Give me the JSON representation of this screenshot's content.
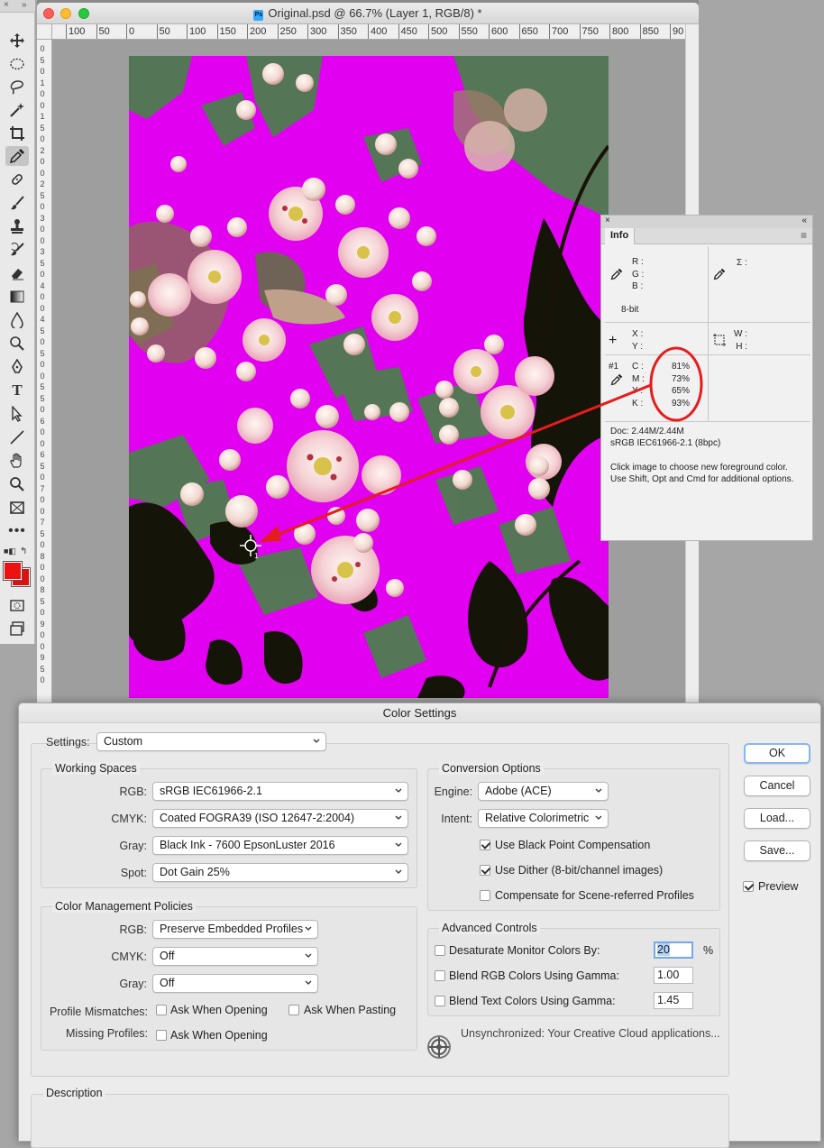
{
  "document": {
    "title": "Original.psd @ 66.7% (Layer 1, RGB/8) *",
    "ruler_h_ticks": [
      "100",
      "50",
      "0",
      "50",
      "100",
      "150",
      "200",
      "250",
      "300",
      "350",
      "400",
      "450",
      "500",
      "550",
      "600",
      "650",
      "700",
      "750",
      "800",
      "850",
      "90"
    ],
    "ruler_v_ticks": [
      "0",
      "5",
      "0",
      "1",
      "0",
      "0",
      "1",
      "5",
      "0",
      "2",
      "0",
      "0",
      "2",
      "5",
      "0",
      "3",
      "0",
      "0",
      "3",
      "5",
      "0",
      "4",
      "0",
      "0",
      "4",
      "5",
      "0",
      "5",
      "0",
      "0",
      "5",
      "5",
      "0",
      "6",
      "0",
      "0",
      "6",
      "5",
      "0",
      "7",
      "0",
      "0",
      "7",
      "5",
      "0",
      "8",
      "0",
      "0",
      "8",
      "5",
      "0",
      "9",
      "0",
      "0",
      "9",
      "5",
      "0"
    ]
  },
  "tools": [
    "move",
    "marquee",
    "lasso",
    "quick-select",
    "crop",
    "eyedropper",
    "healing",
    "brush",
    "stamp",
    "history-brush",
    "eraser",
    "gradient",
    "blur",
    "dodge",
    "pen",
    "type",
    "path-select",
    "line",
    "hand",
    "zoom",
    "frame",
    "more",
    "swap",
    "colors",
    "quickmask",
    "screen-mode"
  ],
  "colors": {
    "foreground": "#ee1111",
    "background": "#dd1111",
    "canvas": "#e100f0",
    "annotation": "#e51c1c"
  },
  "info_panel": {
    "tab": "Info",
    "rgb_labels": [
      "R :",
      "G :",
      "B :"
    ],
    "bit_depth": "8-bit",
    "sigma_label": "Σ :",
    "xy_labels": [
      "X :",
      "Y :"
    ],
    "wh_labels": [
      "W :",
      "H :"
    ],
    "sampler_id": "#1",
    "cmyk": [
      {
        "label": "C :",
        "value": "81%"
      },
      {
        "label": "M :",
        "value": "73%"
      },
      {
        "label": "Y :",
        "value": "65%"
      },
      {
        "label": "K :",
        "value": "93%"
      }
    ],
    "doc_size": "Doc: 2.44M/2.44M",
    "profile": "sRGB IEC61966-2.1 (8bpc)",
    "hint": "Click image to choose new foreground color.  Use Shift, Opt and Cmd for additional options."
  },
  "dialog": {
    "title": "Color Settings",
    "settings_label": "Settings:",
    "settings_value": "Custom",
    "working_spaces": {
      "title": "Working Spaces",
      "rows": [
        {
          "label": "RGB:",
          "value": "sRGB IEC61966-2.1"
        },
        {
          "label": "CMYK:",
          "value": "Coated FOGRA39 (ISO 12647-2:2004)"
        },
        {
          "label": "Gray:",
          "value": "Black Ink - 7600 EpsonLuster 2016"
        },
        {
          "label": "Spot:",
          "value": "Dot Gain 25%"
        }
      ]
    },
    "policies": {
      "title": "Color Management Policies",
      "rows": [
        {
          "label": "RGB:",
          "value": "Preserve Embedded Profiles"
        },
        {
          "label": "CMYK:",
          "value": "Off"
        },
        {
          "label": "Gray:",
          "value": "Off"
        }
      ],
      "mismatch_label": "Profile Mismatches:",
      "mismatch_open": "Ask When Opening",
      "mismatch_paste": "Ask When Pasting",
      "missing_label": "Missing Profiles:",
      "missing_open": "Ask When Opening"
    },
    "conversion": {
      "title": "Conversion Options",
      "engine_label": "Engine:",
      "engine_value": "Adobe (ACE)",
      "intent_label": "Intent:",
      "intent_value": "Relative Colorimetric",
      "black_point": "Use Black Point Compensation",
      "dither": "Use Dither (8-bit/channel images)",
      "scene": "Compensate for Scene-referred Profiles"
    },
    "advanced": {
      "title": "Advanced Controls",
      "desaturate": "Desaturate Monitor Colors By:",
      "desaturate_value": "20",
      "percent": "%",
      "blend_rgb": "Blend RGB Colors Using Gamma:",
      "blend_rgb_value": "1.00",
      "blend_text": "Blend Text Colors Using Gamma:",
      "blend_text_value": "1.45"
    },
    "sync_text": "Unsynchronized: Your Creative Cloud applications...",
    "buttons": {
      "ok": "OK",
      "cancel": "Cancel",
      "load": "Load...",
      "save": "Save..."
    },
    "preview": "Preview",
    "description_title": "Description"
  }
}
